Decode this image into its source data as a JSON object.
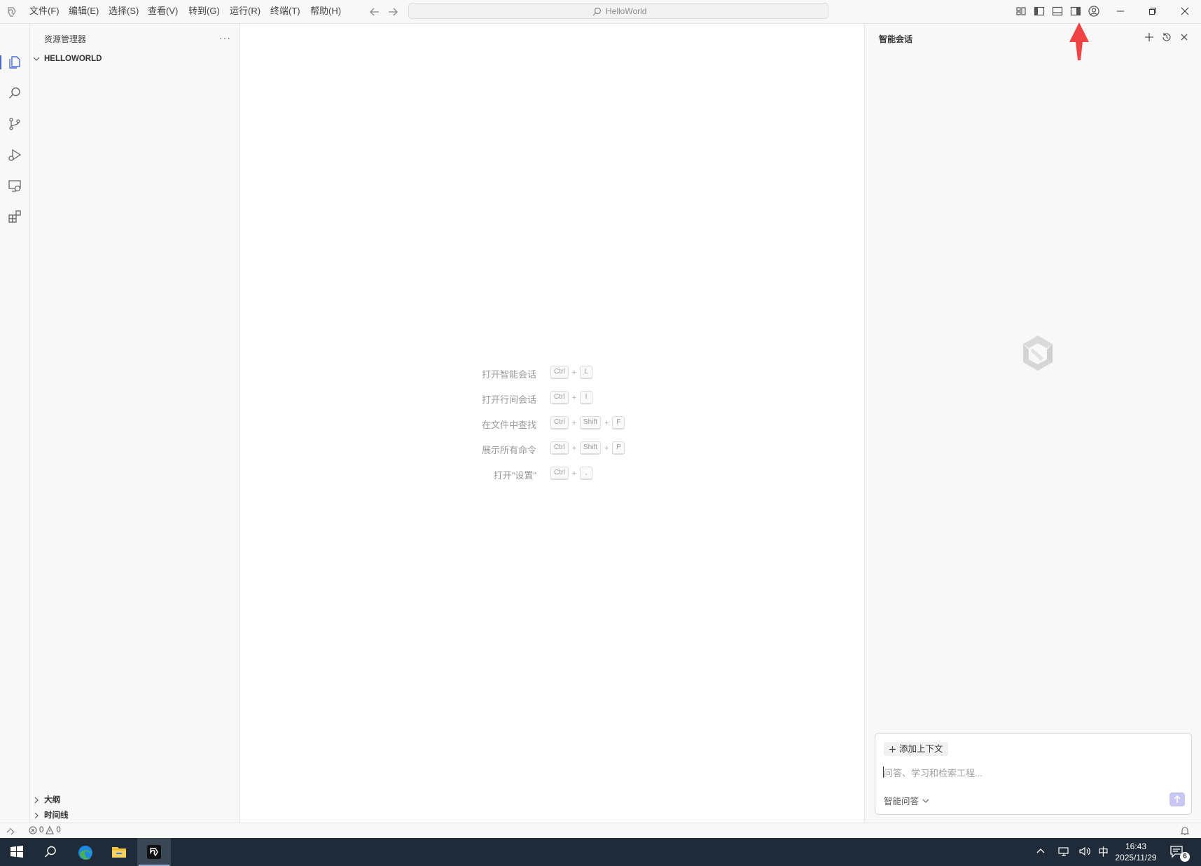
{
  "titlebar": {
    "menus": [
      "文件(F)",
      "编辑(E)",
      "选择(S)",
      "查看(V)",
      "转到(G)",
      "运行(R)",
      "终端(T)",
      "帮助(H)"
    ],
    "command_center_label": "HelloWorld"
  },
  "sidebar": {
    "title": "资源管理器",
    "more": "···",
    "folder": "HELLOWORLD",
    "bottom_sections": [
      "大纲",
      "时间线"
    ]
  },
  "editor": {
    "hints": [
      {
        "label": "打开智能会话",
        "keys": [
          "Ctrl",
          "L"
        ]
      },
      {
        "label": "打开行间会话",
        "keys": [
          "Ctrl",
          "I"
        ]
      },
      {
        "label": "在文件中查找",
        "keys": [
          "Ctrl",
          "Shift",
          "F"
        ]
      },
      {
        "label": "展示所有命令",
        "keys": [
          "Ctrl",
          "Shift",
          "P"
        ]
      },
      {
        "label": "打开\"设置\"",
        "keys": [
          "Ctrl",
          ","
        ]
      }
    ]
  },
  "chat": {
    "title": "智能会话",
    "add_context": "添加上下文",
    "input_placeholder": "问答、学习和检索工程...",
    "mode": "智能问答"
  },
  "statusbar": {
    "errors": "0",
    "warnings": "0"
  },
  "taskbar": {
    "ime": "中",
    "time": "16:43",
    "date": "2025/11/29",
    "notification_count": "6"
  },
  "colors": {
    "accent": "#4a6bd6",
    "annotation_arrow": "#f04343",
    "taskbar_bg": "#1f2b38"
  }
}
